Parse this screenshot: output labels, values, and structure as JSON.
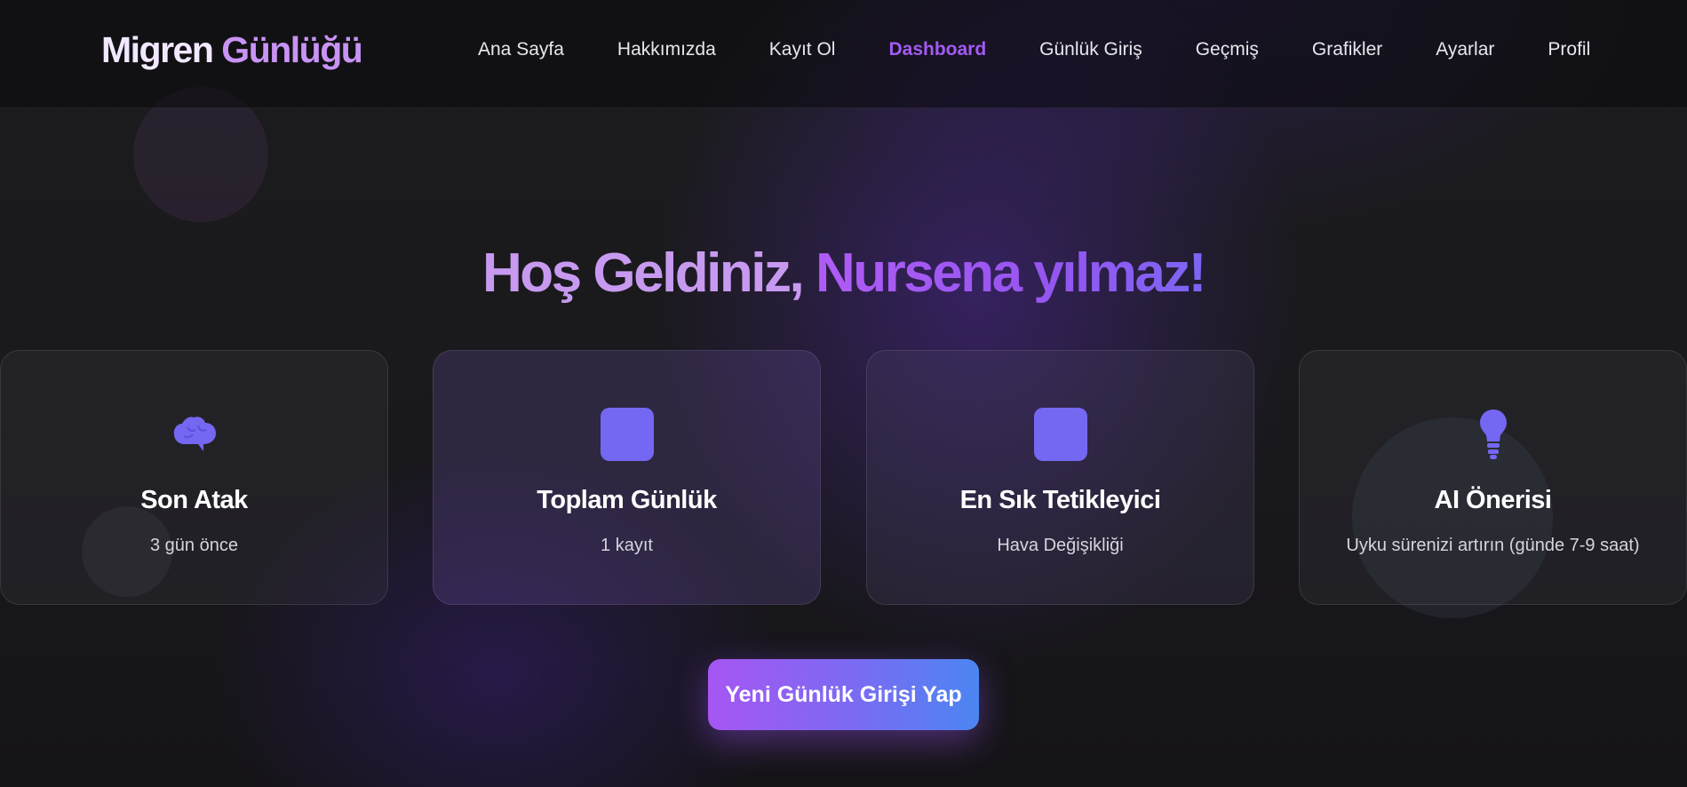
{
  "brand": {
    "part1": "Migren ",
    "part2": "Günlüğü"
  },
  "nav": {
    "items": [
      {
        "label": "Ana Sayfa"
      },
      {
        "label": "Hakkımızda"
      },
      {
        "label": "Kayıt Ol"
      },
      {
        "label": "Dashboard",
        "active": true
      },
      {
        "label": "Günlük Giriş"
      },
      {
        "label": "Geçmiş"
      },
      {
        "label": "Grafikler"
      },
      {
        "label": "Ayarlar"
      },
      {
        "label": "Profil"
      }
    ]
  },
  "hero": {
    "greeting": "Hoş Geldiniz, ",
    "name": "Nursena yılmaz!"
  },
  "cards": [
    {
      "icon": "brain-icon",
      "title": "Son Atak",
      "value": "3 gün önce"
    },
    {
      "icon": "square-icon",
      "title": "Toplam Günlük",
      "value": "1 kayıt"
    },
    {
      "icon": "square-icon",
      "title": "En Sık Tetikleyici",
      "value": "Hava Değişikliği"
    },
    {
      "icon": "lightbulb-icon",
      "title": "AI Önerisi",
      "value": "Uyku sürenizi artırın (günde 7-9 saat)"
    }
  ],
  "cta": {
    "label": "Yeni Günlük Girişi Yap"
  },
  "colors": {
    "accent": "#a25bf2",
    "icon": "#7467f2",
    "cta_start": "#a656f3",
    "cta_end": "#4b86f1"
  }
}
